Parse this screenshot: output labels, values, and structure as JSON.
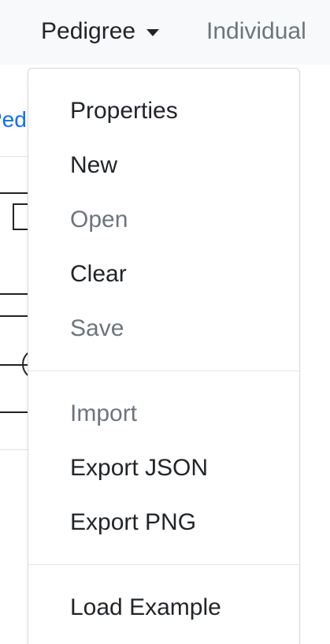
{
  "navbar": {
    "pedigree_label": "Pedigree",
    "individual_label": "Individual"
  },
  "background": {
    "link_fragment": "Pedig"
  },
  "menu": {
    "items": [
      {
        "label": "Properties",
        "enabled": true
      },
      {
        "label": "New",
        "enabled": true
      },
      {
        "label": "Open",
        "enabled": false
      },
      {
        "label": "Clear",
        "enabled": true
      },
      {
        "label": "Save",
        "enabled": false
      },
      {
        "label": "Import",
        "enabled": false
      },
      {
        "label": "Export JSON",
        "enabled": true
      },
      {
        "label": "Export PNG",
        "enabled": true
      },
      {
        "label": "Load Example",
        "enabled": true
      }
    ]
  },
  "colors": {
    "enabled_text": "#212529",
    "disabled_text": "#6c757d",
    "link": "#0d6efd",
    "navbar_bg": "#f8f9fa"
  }
}
